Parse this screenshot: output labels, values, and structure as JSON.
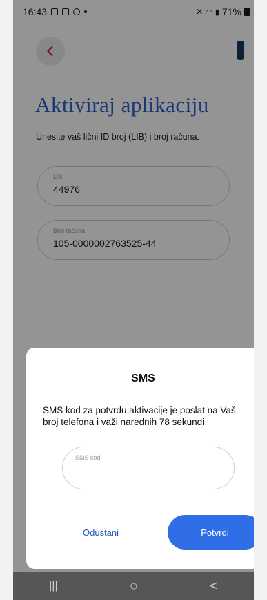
{
  "status_bar": {
    "time": "16:43",
    "battery": "71%"
  },
  "screen": {
    "title": "Aktiviraj aplikaciju",
    "subtitle": "Unesite vaš lični ID broj (LIB) i broj računa.",
    "fields": [
      {
        "label": "LIB",
        "value": "44976"
      },
      {
        "label": "Broj računa",
        "value": "105-0000002763525-44"
      }
    ]
  },
  "dialog": {
    "title": "SMS",
    "message": "SMS kod za potvrdu aktivacije je poslat na Vaš broj telefona i važi narednih 78 sekundi",
    "input_label": "SMS kod",
    "cancel_label": "Odustani",
    "confirm_label": "Potvrdi"
  },
  "navbar": {
    "recent": "|||",
    "home": "○",
    "back": "<"
  },
  "icons": {
    "back": "chevron-left-icon",
    "bookmark": "bookmark-icon"
  },
  "colors": {
    "title_blue": "#2b63c9",
    "confirm_blue": "#2f6ee6",
    "back_red": "#d11f2a"
  }
}
